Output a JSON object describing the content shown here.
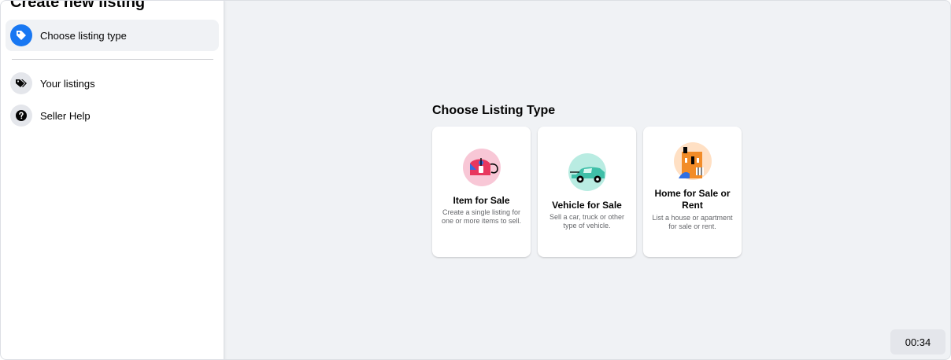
{
  "sidebar": {
    "title": "Create new listing",
    "items": [
      {
        "label": "Choose listing type",
        "icon": "tag-icon",
        "active": true
      },
      {
        "label": "Your listings",
        "icon": "tags-icon",
        "active": false
      },
      {
        "label": "Seller Help",
        "icon": "question-icon",
        "active": false
      }
    ]
  },
  "main": {
    "title": "Choose Listing Type",
    "cards": [
      {
        "title": "Item for Sale",
        "description": "Create a single listing for one or more items to sell.",
        "icon": "item-for-sale-icon"
      },
      {
        "title": "Vehicle for Sale",
        "description": "Sell a car, truck or other type of vehicle.",
        "icon": "vehicle-icon"
      },
      {
        "title": "Home for Sale or Rent",
        "description": "List a house or apartment for sale or rent.",
        "icon": "house-icon"
      }
    ]
  },
  "timer": "00:34",
  "colors": {
    "accent": "#1877f2",
    "background": "#f0f2f5",
    "secondary_text": "#65676b"
  }
}
